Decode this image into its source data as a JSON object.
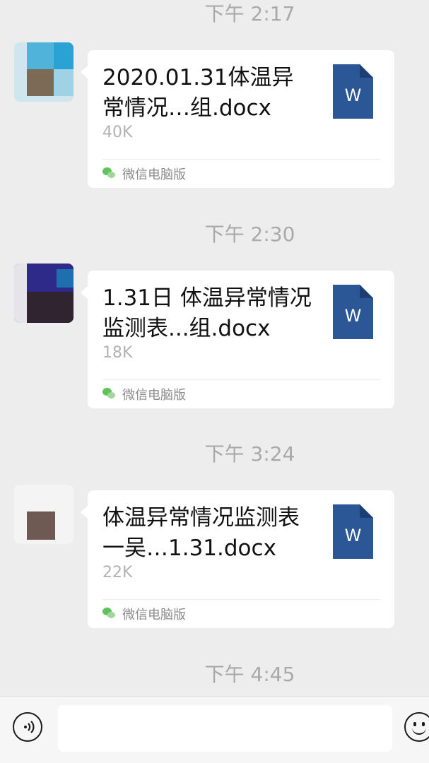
{
  "colors": {
    "background": "#ededed",
    "bubble": "#ffffff",
    "word_blue": "#2b5797",
    "wechat_green": "#5fc25b"
  },
  "messages": [
    {
      "timestamp": "下午 2:17",
      "file_name": "2020.01.31体温异常情况…组.docx",
      "file_size": "40K",
      "source": "微信电脑版",
      "file_icon": "word-doc-icon",
      "file_icon_letter": "W"
    },
    {
      "timestamp": "下午 2:30",
      "file_name": "1.31日 体温异常情况监测表...组.docx",
      "file_size": "18K",
      "source": "微信电脑版",
      "file_icon": "word-doc-icon",
      "file_icon_letter": "W"
    },
    {
      "timestamp": "下午 3:24",
      "file_name": "体温异常情况监测表一吴…1.31.docx",
      "file_size": "22K",
      "source": "微信电脑版",
      "file_icon": "word-doc-icon",
      "file_icon_letter": "W"
    }
  ],
  "last_timestamp": "下午 4:45",
  "input_bar": {
    "voice_icon": "voice-icon",
    "emoji_icon": "emoji-icon",
    "value": ""
  }
}
